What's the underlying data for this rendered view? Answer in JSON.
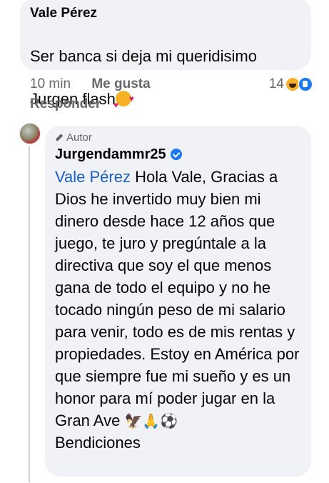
{
  "comment": {
    "author": "Vale Pérez",
    "text_line1": "Ser banca si deja mi queridisimo",
    "text_line2": "Jurgen flash",
    "emoji": "smiling-face-with-hearts",
    "time": "10 min",
    "like_label": "Me gusta",
    "reply_label": "Responder",
    "reaction_count": "14",
    "reactions": [
      "haha-icon",
      "like-icon"
    ]
  },
  "reply": {
    "badge": "Autor",
    "author": "Jurgendammr25",
    "verified": true,
    "mention": "Vale Pérez",
    "text": " Hola Vale, Gracias a Dios he invertido muy bien mi dinero desde hace 12 años que juego, te juro y pregúntale a la directiva que soy el que menos gana de todo el equipo y no he tocado ningún peso de mi salario para venir, todo es de mis rentas y propiedades. Estoy en América por que siempre fue mi sueño y es un honor para mí poder jugar en la Gran Ave",
    "emojis": [
      "🦅",
      "🙏",
      "⚽"
    ],
    "closing": "Bendiciones"
  },
  "colors": {
    "bubble": "#f0f2f5",
    "mention": "#1a5fc9",
    "meta": "#65676b"
  }
}
